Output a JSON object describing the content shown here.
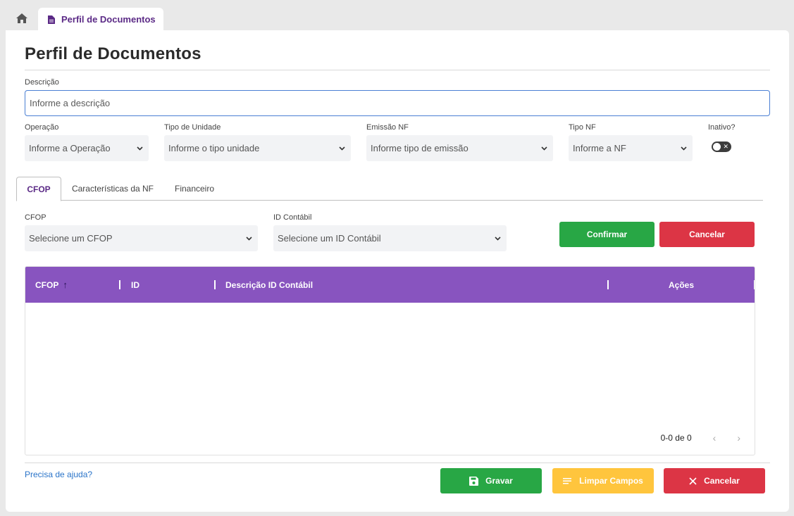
{
  "topbar": {
    "tab_label": "Perfil de Documentos"
  },
  "page": {
    "title": "Perfil de Documentos"
  },
  "form": {
    "descricao": {
      "label": "Descrição",
      "placeholder": "Informe a descrição"
    },
    "operacao": {
      "label": "Operação",
      "value": "Informe a Operação"
    },
    "tipo_unidade": {
      "label": "Tipo de Unidade",
      "value": "Informe o tipo unidade"
    },
    "emissao_nf": {
      "label": "Emissão NF",
      "value": "Informe tipo de emissão"
    },
    "tipo_nf": {
      "label": "Tipo NF",
      "value": "Informe a NF"
    },
    "inativo": {
      "label": "Inativo?",
      "off_symbol": "✕"
    }
  },
  "subtabs": [
    "CFOP",
    "Características da NF",
    "Financeiro"
  ],
  "cfop_section": {
    "cfop": {
      "label": "CFOP",
      "value": "Selecione um CFOP"
    },
    "id_contabil": {
      "label": "ID Contábil",
      "value": "Selecione um ID Contábil"
    },
    "confirm_label": "Confirmar",
    "cancel_label": "Cancelar"
  },
  "table": {
    "columns": [
      "CFOP",
      "ID",
      "Descrição ID Contábil",
      "Ações"
    ],
    "sort_indicator": "↑",
    "rows": [],
    "pager": {
      "range": "0-0 de 0",
      "prev": "‹",
      "next": "›"
    }
  },
  "footer": {
    "help": "Precisa de ajuda?",
    "save_label": "Gravar",
    "clear_label": "Limpar Campos",
    "cancel_label": "Cancelar"
  },
  "colors": {
    "accent_purple": "#8854bf",
    "tab_text": "#5b2a86",
    "green": "#28a745",
    "red": "#dc3545",
    "yellow": "#ffc53d"
  }
}
